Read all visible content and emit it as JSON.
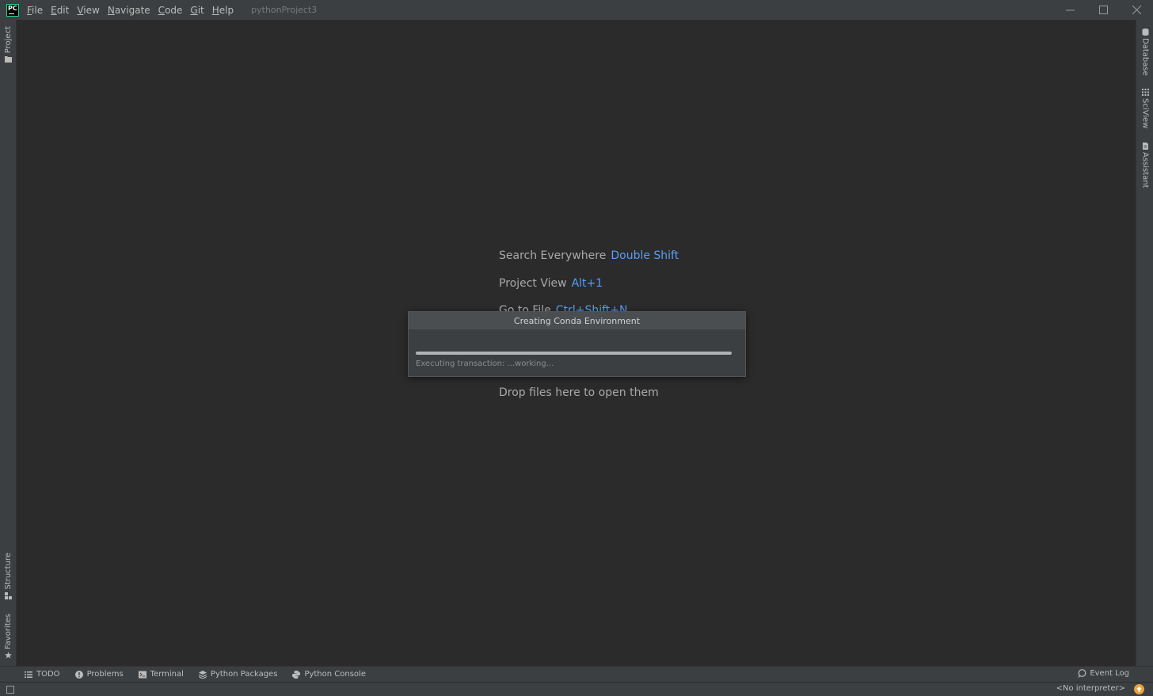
{
  "app": {
    "logo_text": "PC",
    "project_name": "pythonProject3",
    "accent_color": "#21d789"
  },
  "menu": [
    "File",
    "Edit",
    "View",
    "Navigate",
    "Code",
    "Git",
    "Help"
  ],
  "window_controls": [
    "minimize-icon",
    "maximize-icon",
    "close-icon"
  ],
  "left_strip": {
    "project": "Project",
    "structure": "Structure",
    "favorites": "Favorites"
  },
  "right_strip": {
    "database": "Database",
    "sciview": "SciView",
    "assistant": "Assistant"
  },
  "editor_hints": [
    {
      "label": "Search Everywhere",
      "shortcut": "Double Shift"
    },
    {
      "label": "Project View",
      "shortcut": "Alt+1"
    },
    {
      "label": "Go to File",
      "shortcut": "Ctrl+Shift+N"
    },
    {
      "label": "Drop files here to open them",
      "shortcut": ""
    }
  ],
  "dialog": {
    "title": "Creating Conda Environment",
    "status": "Executing transaction: ...working...",
    "progress": 1.0
  },
  "bottom_tabs": {
    "todo": "TODO",
    "problems": "Problems",
    "terminal": "Terminal",
    "python_packages": "Python Packages",
    "python_console": "Python Console",
    "event_log": "Event Log"
  },
  "status_bar": {
    "interpreter": "<No interpreter>"
  },
  "colors": {
    "shortcut": "#589df6",
    "background": "#2b2b2b",
    "panel": "#3c3f41",
    "notification": "#e8a33d"
  }
}
